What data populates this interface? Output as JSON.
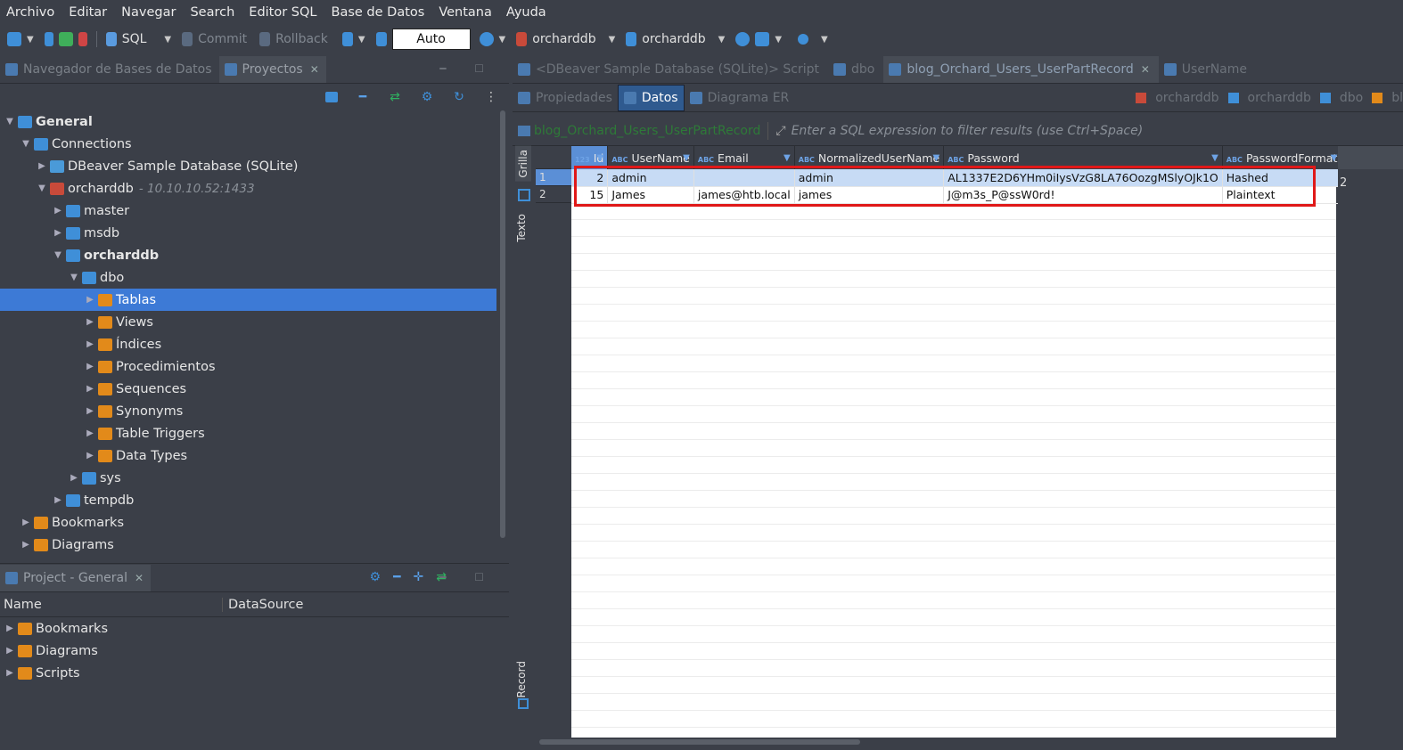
{
  "menu": [
    "Archivo",
    "Editar",
    "Navegar",
    "Search",
    "Editor SQL",
    "Base de Datos",
    "Ventana",
    "Ayuda"
  ],
  "toolbar": {
    "sql_label": "SQL",
    "commit_label": "Commit",
    "rollback_label": "Rollback",
    "mode_value": "Auto",
    "datasource_label": "orcharddb",
    "schema_label": "orcharddb"
  },
  "left_panel": {
    "tabs": [
      {
        "label": "Navegador de Bases de Datos",
        "active": false
      },
      {
        "label": "Proyectos",
        "active": true
      }
    ],
    "tree": [
      {
        "label": "General",
        "level": 0,
        "expanded": true,
        "bold": true,
        "icon": "project-icon"
      },
      {
        "label": "Connections",
        "level": 1,
        "expanded": true,
        "icon": "connections-icon"
      },
      {
        "label": "DBeaver Sample Database (SQLite)",
        "level": 2,
        "expanded": false,
        "icon": "sqlite-db-icon"
      },
      {
        "label": "orcharddb",
        "sub": "- 10.10.10.52:1433",
        "level": 2,
        "expanded": true,
        "icon": "mssql-connection-icon"
      },
      {
        "label": "master",
        "level": 3,
        "expanded": false,
        "icon": "database-icon"
      },
      {
        "label": "msdb",
        "level": 3,
        "expanded": false,
        "icon": "database-icon"
      },
      {
        "label": "orcharddb",
        "level": 3,
        "expanded": true,
        "bold": true,
        "icon": "database-icon"
      },
      {
        "label": "dbo",
        "level": 4,
        "expanded": true,
        "icon": "schema-icon"
      },
      {
        "label": "Tablas",
        "level": 5,
        "expanded": false,
        "selected": true,
        "icon": "tables-icon"
      },
      {
        "label": "Views",
        "level": 5,
        "expanded": false,
        "icon": "views-icon"
      },
      {
        "label": "Índices",
        "level": 5,
        "expanded": false,
        "icon": "folder-icon"
      },
      {
        "label": "Procedimientos",
        "level": 5,
        "expanded": false,
        "icon": "folder-icon"
      },
      {
        "label": "Sequences",
        "level": 5,
        "expanded": false,
        "icon": "folder-icon"
      },
      {
        "label": "Synonyms",
        "level": 5,
        "expanded": false,
        "icon": "folder-icon"
      },
      {
        "label": "Table Triggers",
        "level": 5,
        "expanded": false,
        "icon": "folder-icon"
      },
      {
        "label": "Data Types",
        "level": 5,
        "expanded": false,
        "icon": "folder-icon"
      },
      {
        "label": "sys",
        "level": 4,
        "expanded": false,
        "icon": "schema-icon"
      },
      {
        "label": "tempdb",
        "level": 3,
        "expanded": false,
        "icon": "database-icon"
      },
      {
        "label": "Bookmarks",
        "level": 1,
        "expanded": false,
        "icon": "bookmarks-icon"
      },
      {
        "label": "Diagrams",
        "level": 1,
        "expanded": false,
        "icon": "diagrams-icon"
      }
    ]
  },
  "project_panel": {
    "tab_label": "Project - General",
    "col_name": "Name",
    "col_datasource": "DataSource",
    "items": [
      "Bookmarks",
      "Diagrams",
      "Scripts"
    ]
  },
  "editor": {
    "tabs": [
      {
        "label": "<DBeaver Sample Database (SQLite)> Script",
        "active": false
      },
      {
        "label": "dbo",
        "active": false
      },
      {
        "label": "blog_Orchard_Users_UserPartRecord",
        "active": true
      },
      {
        "label": "UserName",
        "active": false
      }
    ],
    "sub_tabs": [
      {
        "label": "Propiedades",
        "active": false
      },
      {
        "label": "Datos",
        "active": true
      },
      {
        "label": "Diagrama ER",
        "active": false
      }
    ],
    "sub_right": [
      "orcharddb",
      "orcharddb",
      "dbo",
      "bl"
    ],
    "filter_entity": "blog_Orchard_Users_UserPartRecord",
    "filter_placeholder": "Enter a SQL expression to filter results (use Ctrl+Space)",
    "side_labels": {
      "grid": "Grilla",
      "text": "Texto",
      "record": "Record"
    }
  },
  "grid": {
    "columns": [
      {
        "label": "Id",
        "type": "123"
      },
      {
        "label": "UserName",
        "type": "ABC"
      },
      {
        "label": "Email",
        "type": "ABC"
      },
      {
        "label": "NormalizedUserName",
        "type": "ABC"
      },
      {
        "label": "Password",
        "type": "ABC"
      },
      {
        "label": "PasswordFormat",
        "type": "ABC"
      }
    ],
    "rows": [
      {
        "num": "1",
        "cells": [
          "2",
          "admin",
          "",
          "admin",
          "AL1337E2D6YHm0iIysVzG8LA76OozgMSlyOJk1O",
          "Hashed"
        ],
        "selected": true
      },
      {
        "num": "2",
        "cells": [
          "15",
          "James",
          "james@htb.local",
          "james",
          "J@m3s_P@ssW0rd!",
          "Plaintext"
        ],
        "selected": false
      }
    ],
    "record_value": "2"
  },
  "colors": {
    "accent": "#3d7ad6",
    "highlight_border": "#e01818",
    "selected_row": "#c7dbf5"
  }
}
